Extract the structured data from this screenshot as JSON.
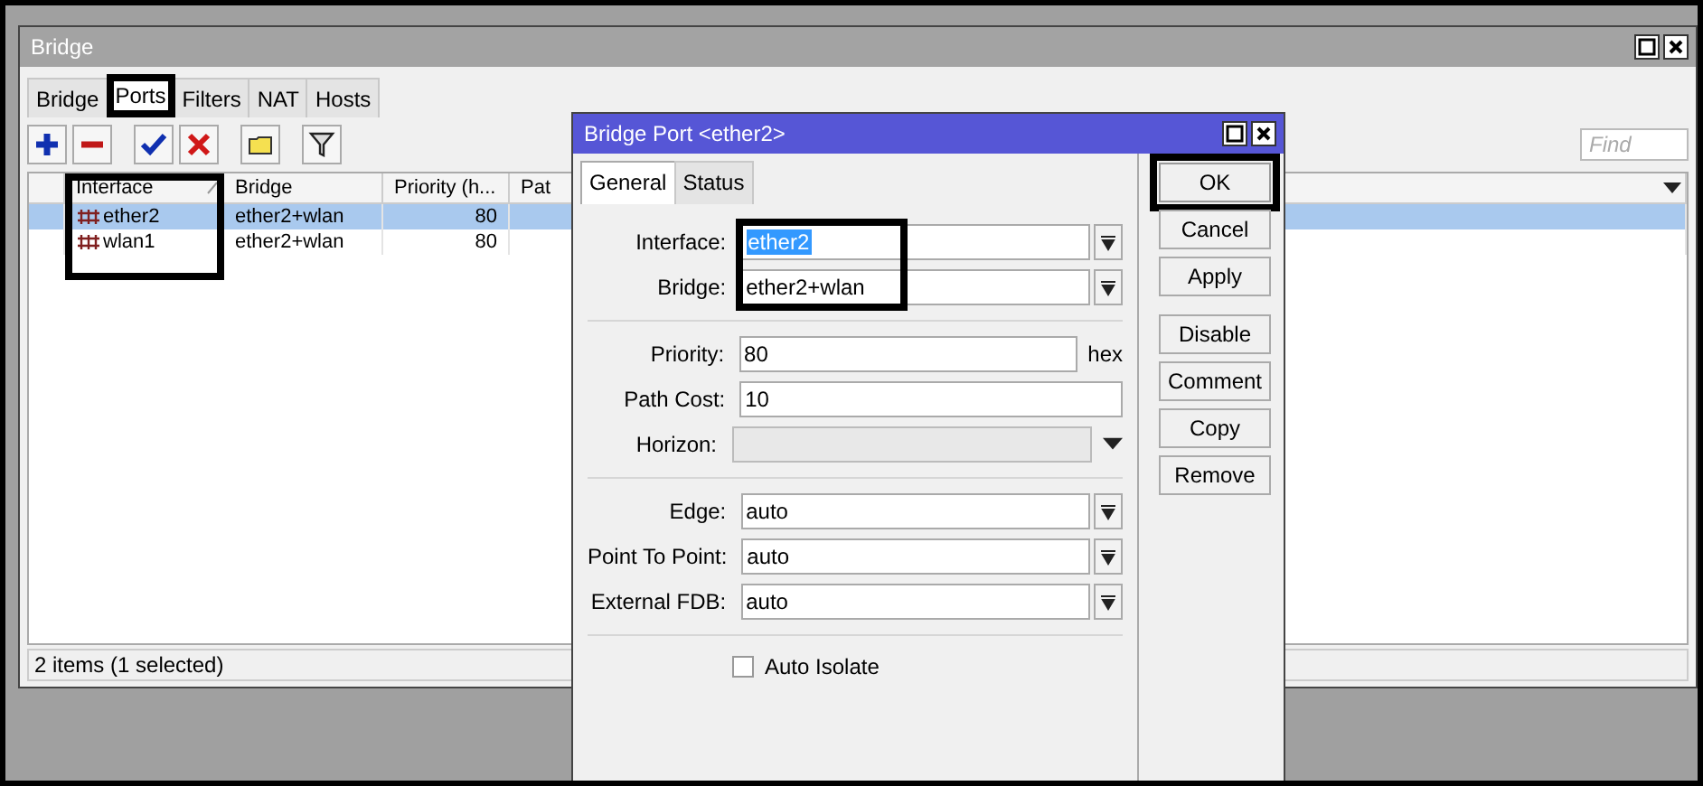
{
  "main_window": {
    "title": "Bridge",
    "controls": [
      {
        "kind": "maximize"
      },
      {
        "kind": "close"
      }
    ],
    "tabs": [
      {
        "label": "Bridge",
        "selected": false,
        "highlighted": false
      },
      {
        "label": "Ports",
        "selected": true,
        "highlighted": true
      },
      {
        "label": "Filters",
        "selected": false,
        "highlighted": false
      },
      {
        "label": "NAT",
        "selected": false,
        "highlighted": false
      },
      {
        "label": "Hosts",
        "selected": false,
        "highlighted": false
      }
    ],
    "toolbar": [
      {
        "kind": "add"
      },
      {
        "kind": "remove"
      },
      {
        "kind": "enable"
      },
      {
        "kind": "disable"
      },
      {
        "kind": "comment"
      },
      {
        "kind": "filter"
      }
    ],
    "find": {
      "placeholder": "Find"
    },
    "table": {
      "columns": [
        {
          "highlighted": false
        },
        {
          "label": "Interface",
          "sorted": true,
          "highlighted": true
        },
        {
          "label": "Bridge",
          "sorted": false,
          "highlighted": false
        },
        {
          "label": "Priority (h...",
          "sorted": false,
          "highlighted": false
        },
        {
          "label": "Pat",
          "sorted": false,
          "highlighted": false
        }
      ],
      "rows": [
        {
          "interface": "ether2",
          "bridge": "ether2+wlan",
          "priority": "80",
          "selected": true
        },
        {
          "interface": "wlan1",
          "bridge": "ether2+wlan",
          "priority": "80",
          "selected": false
        }
      ]
    },
    "status_bar": "2 items (1 selected)"
  },
  "dialog": {
    "title": "Bridge Port <ether2>",
    "controls": [
      {
        "kind": "maximize"
      },
      {
        "kind": "close"
      }
    ],
    "tabs": [
      {
        "label": "General",
        "selected": true
      },
      {
        "label": "Status",
        "selected": false
      }
    ],
    "field_groups": [
      [
        {
          "kind": "select",
          "label": "Interface:",
          "value": "ether2",
          "value_selected": true,
          "highlighted": true
        },
        {
          "kind": "select",
          "label": "Bridge:",
          "value": "ether2+wlan",
          "value_selected": false,
          "highlighted": true
        }
      ],
      [
        {
          "kind": "text",
          "label": "Priority:",
          "value": "80",
          "suffix": "hex",
          "highlighted": false
        },
        {
          "kind": "text",
          "label": "Path Cost:",
          "value": "10",
          "highlighted": false
        },
        {
          "kind": "optional",
          "label": "Horizon:",
          "disabled": true,
          "highlighted": false
        }
      ],
      [
        {
          "kind": "select",
          "label": "Edge:",
          "value": "auto",
          "value_selected": false,
          "highlighted": false
        },
        {
          "kind": "select",
          "label": "Point To Point:",
          "value": "auto",
          "value_selected": false,
          "highlighted": false
        },
        {
          "kind": "select",
          "label": "External FDB:",
          "value": "auto",
          "value_selected": false,
          "highlighted": false
        }
      ]
    ],
    "checkbox": {
      "label": "Auto Isolate",
      "checked": false
    },
    "button_groups": [
      [
        {
          "label": "OK",
          "highlighted": true
        },
        {
          "label": "Cancel",
          "highlighted": false
        },
        {
          "label": "Apply",
          "highlighted": false
        }
      ],
      [
        {
          "label": "Disable",
          "highlighted": false
        },
        {
          "label": "Comment",
          "highlighted": false
        },
        {
          "label": "Copy",
          "highlighted": false
        },
        {
          "label": "Remove",
          "highlighted": false
        }
      ]
    ]
  }
}
